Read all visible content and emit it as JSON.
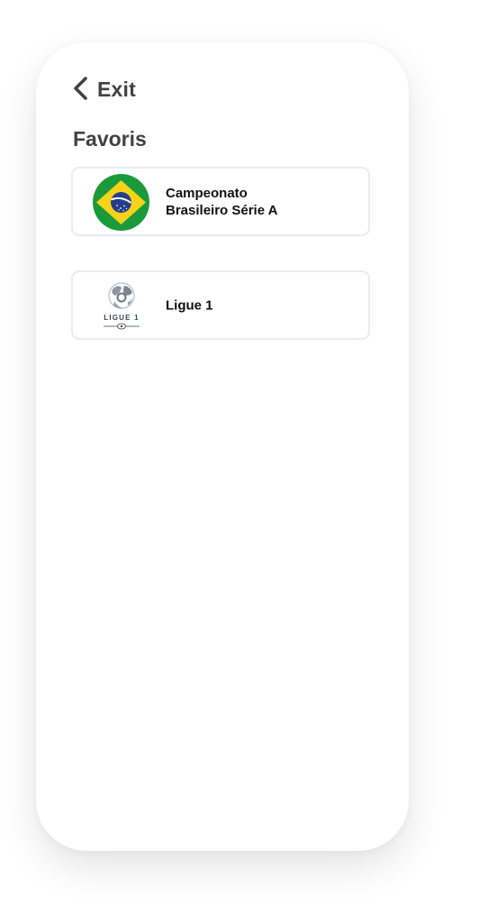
{
  "header": {
    "back_label": "Exit",
    "back_icon": "chevron-left-icon"
  },
  "page": {
    "title": "Favoris"
  },
  "favorites": [
    {
      "name_line1": "Campeonato",
      "name_line2": "Brasileiro Série A",
      "logo": "brazil-flag-icon"
    },
    {
      "name_line1": "Ligue 1",
      "logo": "ligue-1-logo",
      "logo_text": "LIGUE 1"
    }
  ],
  "colors": {
    "text_dark": "#424242",
    "card_border": "#ece9f6",
    "brazil_green": "#1b9a3b",
    "brazil_yellow": "#f7d218",
    "brazil_blue": "#243c8a"
  }
}
